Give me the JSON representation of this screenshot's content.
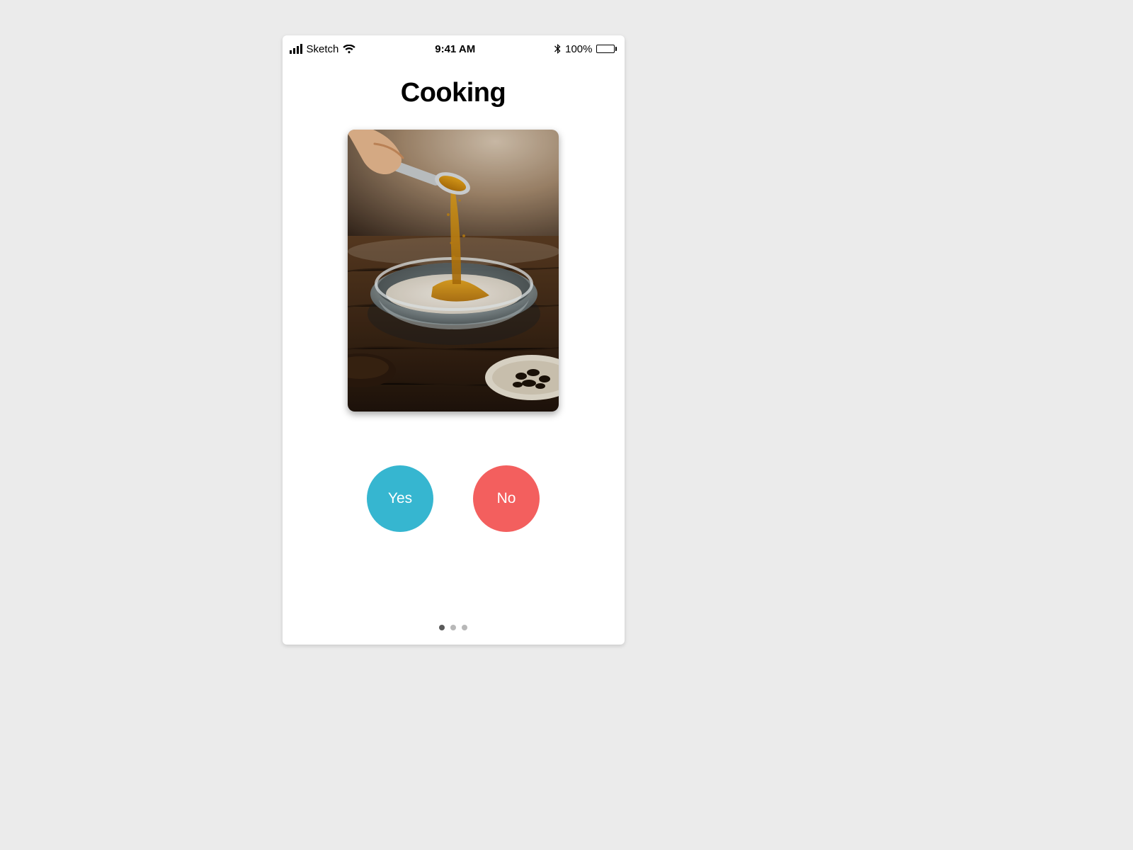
{
  "status_bar": {
    "carrier": "Sketch",
    "time": "9:41 AM",
    "battery_percent": "100%"
  },
  "page": {
    "title": "Cooking",
    "image_alt": "cooking-spice-bowl"
  },
  "buttons": {
    "yes": "Yes",
    "no": "No"
  },
  "pagination": {
    "count": 3,
    "active_index": 0
  },
  "colors": {
    "yes_button": "#36b6d0",
    "no_button": "#f35f5e",
    "background": "#ebebeb",
    "phone_bg": "#ffffff"
  }
}
